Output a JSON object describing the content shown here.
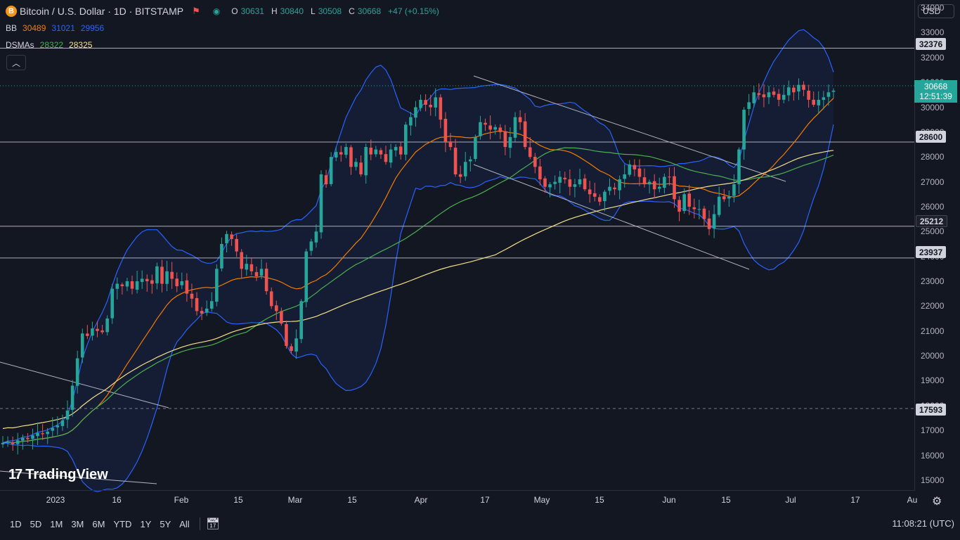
{
  "header": {
    "symbol_icon": "B",
    "title": "Bitcoin / U.S. Dollar · 1D · BITSTAMP",
    "ohlc": [
      {
        "key": "O",
        "value": "30631"
      },
      {
        "key": "H",
        "value": "30840"
      },
      {
        "key": "L",
        "value": "30508"
      },
      {
        "key": "C",
        "value": "30668"
      }
    ],
    "change": "+47 (+0.15%)"
  },
  "indicators": {
    "bb": {
      "label": "BB",
      "v1": "30489",
      "v2": "31021",
      "v3": "29956"
    },
    "dsma": {
      "label": "DSMAs",
      "v1": "28322",
      "v2": "28325"
    }
  },
  "currency": "USD",
  "price_tag": {
    "price": "30668",
    "countdown": "12:51:39"
  },
  "level_tags": [
    "32376",
    "28600",
    "25212",
    "23937",
    "17593"
  ],
  "price_ticks": [
    "34000",
    "33000",
    "32000",
    "31000",
    "30000",
    "29000",
    "28000",
    "27000",
    "26000",
    "25000",
    "24000",
    "23000",
    "22000",
    "21000",
    "20000",
    "19000",
    "18000",
    "17000",
    "16000",
    "15000"
  ],
  "x_labels": [
    "2023",
    "16",
    "Feb",
    "15",
    "Mar",
    "15",
    "Apr",
    "17",
    "May",
    "15",
    "Jun",
    "15",
    "Jul",
    "17",
    "Au"
  ],
  "ranges": [
    "1D",
    "5D",
    "1M",
    "3M",
    "6M",
    "YTD",
    "1Y",
    "5Y",
    "All"
  ],
  "timestamp": "11:08:21 (UTC)",
  "watermark": "TradingView",
  "colors": {
    "up": "#26a69a",
    "down": "#ef5350",
    "bb": "#2962ff",
    "ma_fast": "#f57c00",
    "ma_mid": "#4caf50",
    "ma_slow": "#f5e08a"
  },
  "chart_data": {
    "type": "candlestick",
    "title": "Bitcoin / U.S. Dollar · 1D · BITSTAMP",
    "ylim": [
      14600,
      34200
    ],
    "horizontal_levels": [
      32376,
      28600,
      25212,
      23937,
      17593
    ],
    "candles_close": [
      16500,
      16550,
      16450,
      16600,
      16700,
      16650,
      16800,
      16900,
      16850,
      16950,
      17100,
      17200,
      17400,
      17800,
      18800,
      19900,
      20900,
      20800,
      21100,
      21000,
      20950,
      21500,
      22700,
      22900,
      22800,
      23000,
      22700,
      23000,
      23100,
      23000,
      22900,
      23600,
      22900,
      23400,
      23100,
      22800,
      23000,
      22500,
      22300,
      21800,
      21700,
      21900,
      22200,
      23500,
      24500,
      24900,
      24700,
      24200,
      23500,
      23700,
      23400,
      23200,
      23500,
      22600,
      22000,
      21800,
      21300,
      20400,
      20200,
      20700,
      22200,
      24200,
      24600,
      25000,
      27300,
      26900,
      28000,
      28200,
      28100,
      28400,
      27600,
      27800,
      27300,
      28400,
      28100,
      28300,
      28100,
      27800,
      28300,
      28400,
      28100,
      29300,
      29600,
      30000,
      30300,
      30100,
      30000,
      30400,
      29500,
      28600,
      28400,
      27300,
      27200,
      27800,
      27900,
      28800,
      29400,
      29300,
      29100,
      29200,
      29000,
      28400,
      28800,
      29600,
      29400,
      28400,
      28000,
      27600,
      27100,
      26800,
      26900,
      27000,
      27200,
      27100,
      26800,
      26900,
      27100,
      26700,
      26500,
      26400,
      26200,
      26600,
      26800,
      26700,
      27100,
      27300,
      27700,
      27500,
      27200,
      26900,
      27000,
      26700,
      26800,
      27200,
      27200,
      26300,
      25800,
      26500,
      26000,
      25900,
      25900,
      25500,
      25100,
      25700,
      26400,
      26300,
      26400,
      26900,
      28300,
      29900,
      30200,
      30600,
      30500,
      30400,
      30600,
      30500,
      30300,
      30500,
      30800,
      30600,
      30900,
      30700,
      30300,
      30100,
      30300,
      30400,
      30600,
      30668
    ],
    "series": [
      {
        "name": "BB",
        "values": [
          30489,
          31021,
          29956
        ]
      },
      {
        "name": "DSMAs",
        "values": [
          28322,
          28325
        ]
      }
    ]
  }
}
